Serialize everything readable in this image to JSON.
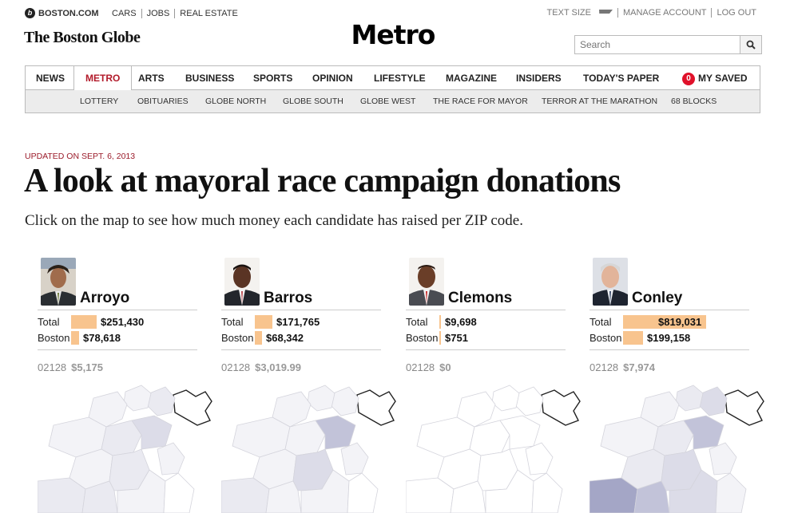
{
  "topbar": {
    "site": "BOSTON.COM",
    "links": [
      "CARS",
      "JOBS",
      "REAL ESTATE"
    ],
    "account": [
      "TEXT SIZE",
      "MANAGE ACCOUNT",
      "LOG OUT"
    ]
  },
  "masthead": {
    "paper_name": "The Boston Globe",
    "section": "Metro"
  },
  "search": {
    "placeholder": "Search"
  },
  "nav": {
    "items": [
      "NEWS",
      "METRO",
      "ARTS",
      "BUSINESS",
      "SPORTS",
      "OPINION",
      "LIFESTYLE",
      "MAGAZINE",
      "INSIDERS",
      "TODAY'S PAPER"
    ],
    "saved_count": "0",
    "saved_label": "MY SAVED",
    "active": "METRO"
  },
  "subnav": [
    "LOTTERY",
    "OBITUARIES",
    "GLOBE NORTH",
    "GLOBE SOUTH",
    "GLOBE WEST",
    "THE RACE FOR MAYOR",
    "TERROR AT THE MARATHON",
    "68 BLOCKS"
  ],
  "article": {
    "updated": "UPDATED ON SEPT. 6, 2013",
    "headline": "A look at mayoral race campaign donations",
    "dek": "Click on the map to see how much money each candidate has raised per ZIP code."
  },
  "row_labels": {
    "total": "Total",
    "boston": "Boston"
  },
  "candidates": [
    {
      "name": "Arroyo",
      "total": "$251,430",
      "boston": "$78,618",
      "total_frac": 0.307,
      "boston_frac": 0.096,
      "zip": "02128",
      "zip_amount": "$5,175"
    },
    {
      "name": "Barros",
      "total": "$171,765",
      "boston": "$68,342",
      "total_frac": 0.21,
      "boston_frac": 0.083,
      "zip": "02128",
      "zip_amount": "$3,019.99"
    },
    {
      "name": "Clemons",
      "total": "$9,698",
      "boston": "$751",
      "total_frac": 0.012,
      "boston_frac": 0.001,
      "zip": "02128",
      "zip_amount": "$0"
    },
    {
      "name": "Conley",
      "total": "$819,031",
      "boston": "$199,158",
      "total_frac": 1.0,
      "boston_frac": 0.243,
      "zip": "02128",
      "zip_amount": "$7,974"
    }
  ],
  "colors": {
    "accent_red": "#b21a2a",
    "bar": "#f8c48e",
    "map_light": "#eeeef4",
    "map_mid": "#c9c9dc",
    "map_dark": "#9a9cbf"
  },
  "icons": [
    "boston-com-logo-icon",
    "caret-down-icon",
    "search-icon"
  ]
}
